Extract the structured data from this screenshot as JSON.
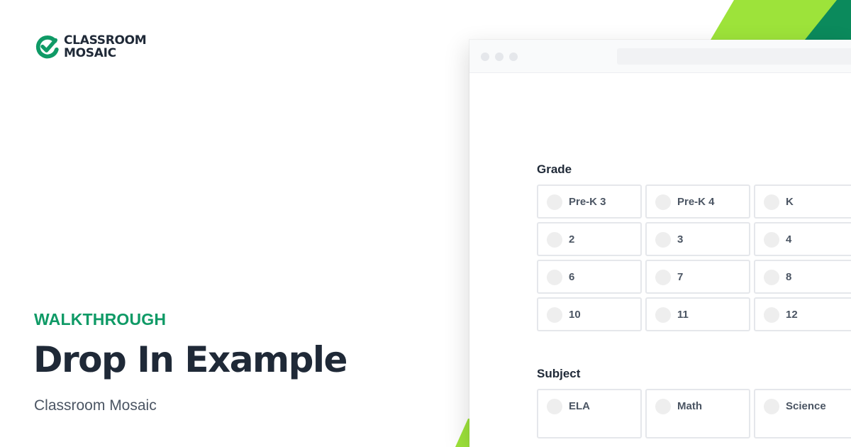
{
  "brand": {
    "logo_line1": "CLASSROOM",
    "logo_line2": "MOSAIC",
    "accent_color": "#0f9a66",
    "lime_color": "#9de33a",
    "dark_green_color": "#0b8a5c"
  },
  "hero": {
    "eyebrow": "WALKTHROUGH",
    "title": "Drop In Example",
    "subtitle": "Classroom Mosaic"
  },
  "form": {
    "grade": {
      "label": "Grade",
      "options": [
        "Pre-K 3",
        "Pre-K 4",
        "K",
        "2",
        "3",
        "4",
        "6",
        "7",
        "8",
        "10",
        "11",
        "12"
      ]
    },
    "subject": {
      "label": "Subject",
      "options": [
        "ELA",
        "Math",
        "Science"
      ]
    }
  }
}
